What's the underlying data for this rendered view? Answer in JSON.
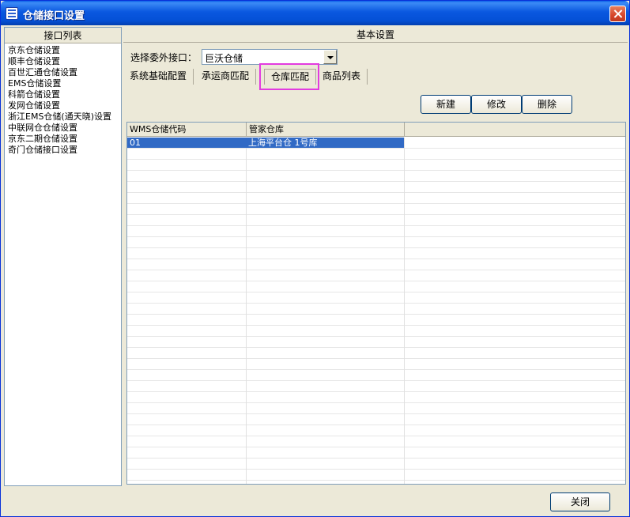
{
  "window": {
    "title": "仓储接口设置"
  },
  "left_panel": {
    "header": "接口列表",
    "items": [
      "京东仓储设置",
      "顺丰仓储设置",
      "百世汇通仓储设置",
      "EMS仓储设置",
      "科箭仓储设置",
      "发网仓储设置",
      "浙江EMS仓储(通天晓)设置",
      "中联网仓仓储设置",
      "京东二期仓储设置",
      "奇门仓储接口设置"
    ]
  },
  "right_panel": {
    "header": "基本设置",
    "select_label": "选择委外接口：",
    "select_value": "巨沃仓储",
    "tabs": [
      "系统基础配置",
      "承运商匹配",
      "仓库匹配",
      "商品列表"
    ],
    "active_tab": "仓库匹配",
    "highlight_color": "#e23be0",
    "buttons": {
      "new": "新建",
      "edit": "修改",
      "delete": "删除"
    },
    "grid": {
      "columns": [
        "WMS仓储代码",
        "管家仓库",
        ""
      ],
      "rows": [
        {
          "code": "01",
          "warehouse": "上海平台仓 1号库",
          "extra": "",
          "selected": true
        }
      ]
    }
  },
  "footer": {
    "close_label": "关闭"
  }
}
